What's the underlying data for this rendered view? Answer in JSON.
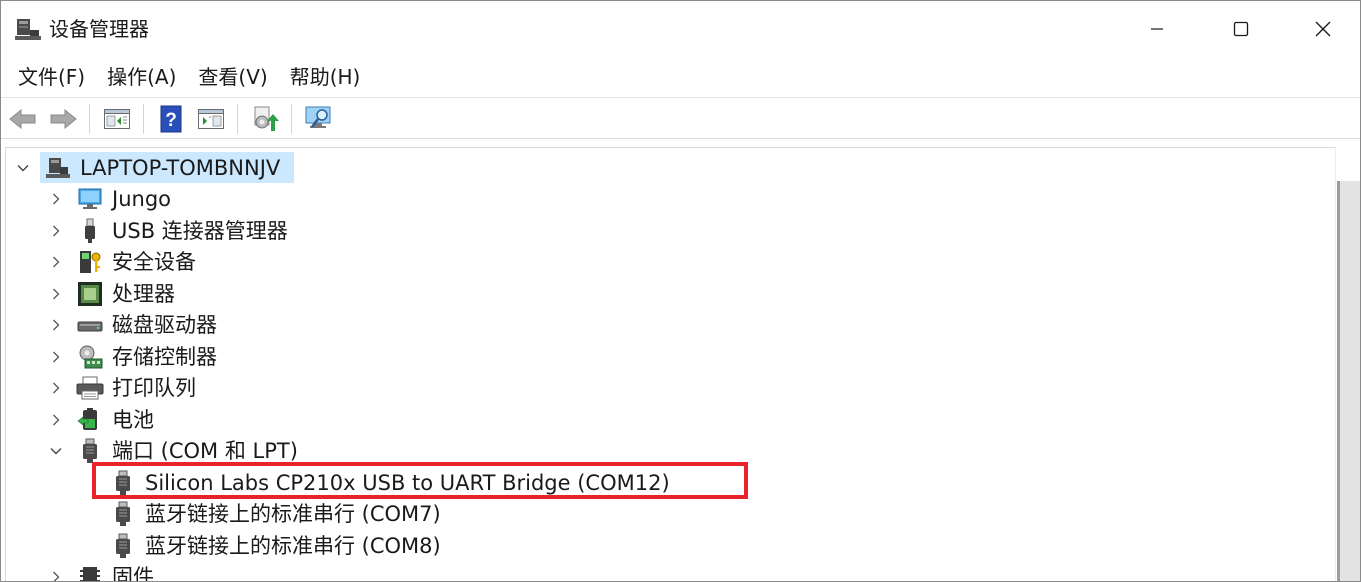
{
  "window": {
    "title": "设备管理器",
    "controls": {
      "minimize": "minimize",
      "maximize": "maximize",
      "close": "close"
    }
  },
  "menubar": {
    "items": [
      {
        "label": "文件(F)"
      },
      {
        "label": "操作(A)"
      },
      {
        "label": "查看(V)"
      },
      {
        "label": "帮助(H)"
      }
    ]
  },
  "toolbar": {
    "buttons": [
      {
        "icon": "back-arrow-icon"
      },
      {
        "icon": "forward-arrow-icon"
      },
      {
        "icon": "show-hide-console-tree-icon"
      },
      {
        "icon": "help-icon"
      },
      {
        "icon": "action-pane-icon"
      },
      {
        "icon": "update-driver-icon"
      },
      {
        "icon": "scan-hardware-icon"
      }
    ]
  },
  "tree": {
    "root": {
      "label": "LAPTOP-TOMBNNJV",
      "expanded": true,
      "selected": true
    },
    "categories": [
      {
        "label": "Jungo",
        "icon": "monitor-icon",
        "expanded": false
      },
      {
        "label": "USB 连接器管理器",
        "icon": "usb-connector-icon",
        "expanded": false
      },
      {
        "label": "安全设备",
        "icon": "security-device-icon",
        "expanded": false
      },
      {
        "label": "处理器",
        "icon": "processor-icon",
        "expanded": false
      },
      {
        "label": "磁盘驱动器",
        "icon": "disk-drive-icon",
        "expanded": false
      },
      {
        "label": "存储控制器",
        "icon": "storage-controller-icon",
        "expanded": false
      },
      {
        "label": "打印队列",
        "icon": "printer-icon",
        "expanded": false
      },
      {
        "label": "电池",
        "icon": "battery-icon",
        "expanded": false
      },
      {
        "label": "端口 (COM 和 LPT)",
        "icon": "port-icon",
        "expanded": true
      },
      {
        "label": "固件",
        "icon": "firmware-icon",
        "expanded": false
      }
    ],
    "ports_children": [
      {
        "label": "Silicon Labs CP210x USB to UART Bridge (COM12)",
        "icon": "port-icon",
        "highlighted": true
      },
      {
        "label": "蓝牙链接上的标准串行 (COM7)",
        "icon": "port-icon"
      },
      {
        "label": "蓝牙链接上的标准串行 (COM8)",
        "icon": "port-icon"
      }
    ]
  },
  "colors": {
    "selection": "#cce8ff",
    "highlight_box": "#e8232a"
  }
}
